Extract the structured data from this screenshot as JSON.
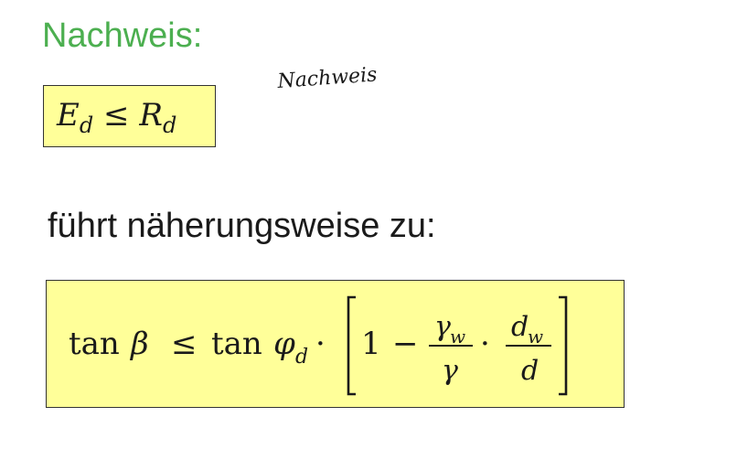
{
  "heading": "Nachweis:",
  "handwritten_note": "Nachweis",
  "condition": {
    "lhs": "E",
    "lhs_sub": "d",
    "relation": "≤",
    "rhs": "R",
    "rhs_sub": "d"
  },
  "subtext": "führt näherungsweise zu:",
  "formula": {
    "tan": "tan",
    "beta": "β",
    "leq": "≤",
    "phi": "φ",
    "phi_sub": "d",
    "dot": "·",
    "one": "1",
    "minus": "−",
    "gamma_w": "γ",
    "gamma_w_sub": "w",
    "gamma": "γ",
    "d_w": "d",
    "d_w_sub": "w",
    "d": "d"
  },
  "colors": {
    "heading": "#4caf50",
    "box_fill": "#ffff99",
    "box_border": "#333333"
  }
}
